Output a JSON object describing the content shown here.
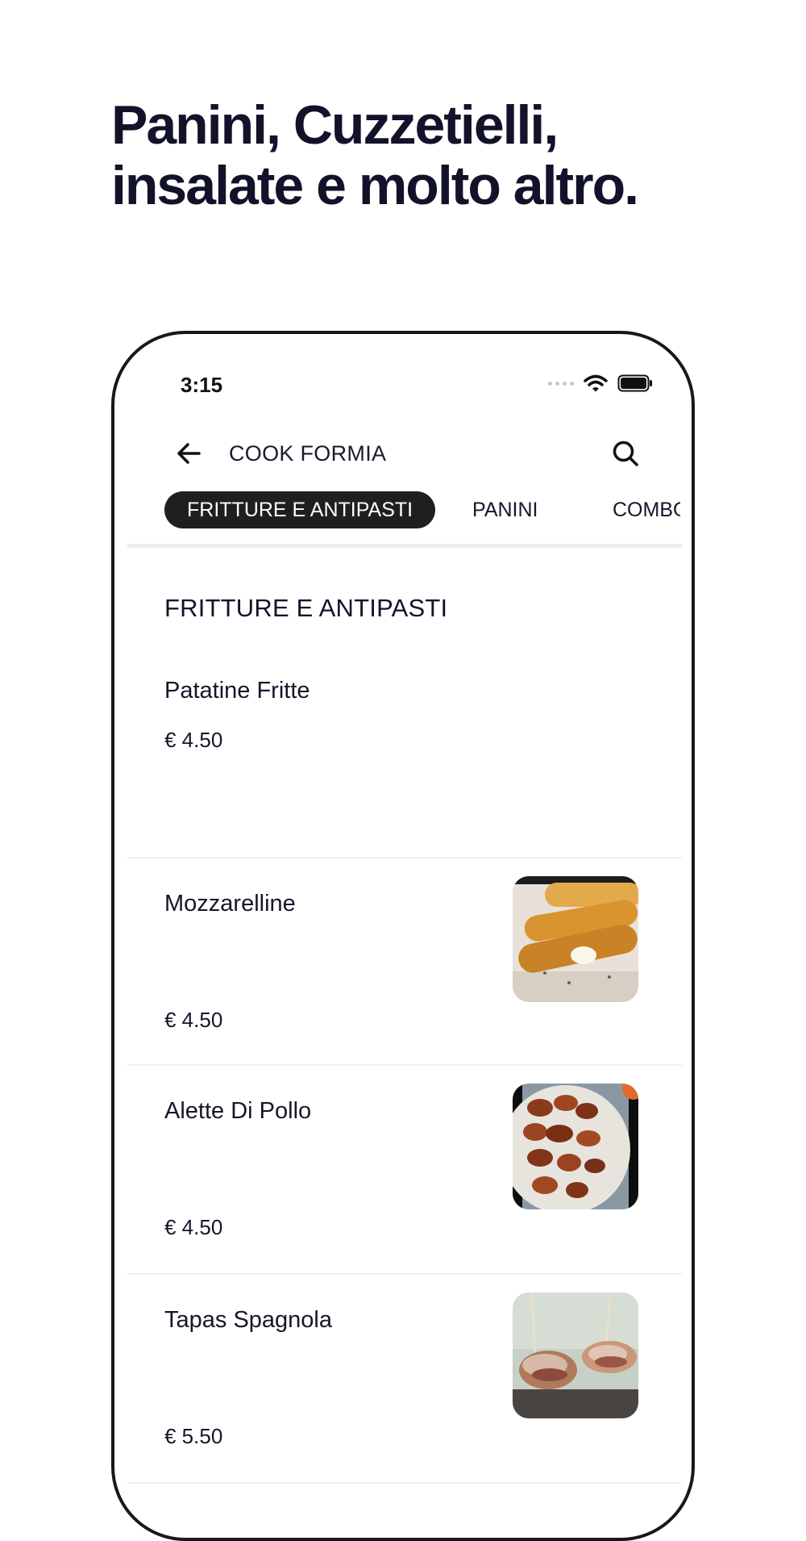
{
  "promo": {
    "line1": "Panini, Cuzzetielli,",
    "line2": "insalate e molto altro."
  },
  "status_bar": {
    "time": "3:15"
  },
  "nav": {
    "store_name": "COOK FORMIA"
  },
  "tabs": [
    {
      "label": "FRITTURE E ANTIPASTI",
      "active": true
    },
    {
      "label": "PANINI",
      "active": false
    },
    {
      "label": "COMBO",
      "active": false
    }
  ],
  "section": {
    "title": "FRITTURE E ANTIPASTI"
  },
  "items": [
    {
      "name": "Patatine Fritte",
      "price": "€ 4.50",
      "image": null
    },
    {
      "name": "Mozzarelline",
      "price": "€ 4.50",
      "image": "fried-mozzarella-sticks-photo"
    },
    {
      "name": "Alette Di Pollo",
      "price": "€ 4.50",
      "image": "chicken-wings-photo"
    },
    {
      "name": "Tapas Spagnola",
      "price": "€ 5.50",
      "image": "tapas-skewers-photo"
    }
  ]
}
